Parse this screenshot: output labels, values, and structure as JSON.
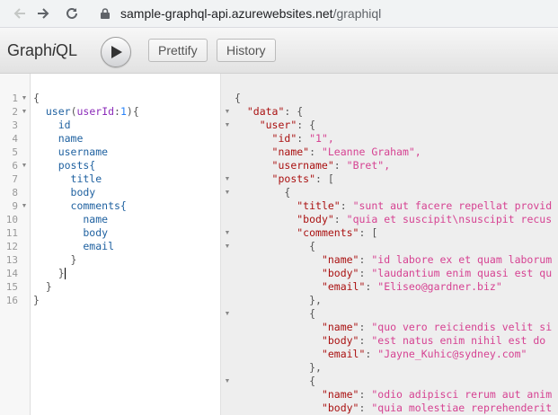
{
  "browser": {
    "url_host": "sample-graphql-api.azurewebsites.net",
    "url_path": "/graphiql"
  },
  "toolbar": {
    "logo_prefix": "Graph",
    "logo_italic": "i",
    "logo_suffix": "QL",
    "prettify_label": "Prettify",
    "history_label": "History"
  },
  "query_editor": {
    "line_numbers": [
      "1",
      "2",
      "3",
      "4",
      "5",
      "6",
      "7",
      "8",
      "9",
      "10",
      "11",
      "12",
      "13",
      "14",
      "15",
      "16"
    ],
    "lines": [
      "{",
      "  user(userId:1){",
      "    id",
      "    name",
      "    username",
      "    posts{",
      "      title",
      "      body",
      "      comments{",
      "        name",
      "        body",
      "        email",
      "      }",
      "    }",
      "  }",
      "}"
    ]
  },
  "result_viewer": {
    "lines": [
      "{",
      "  \"data\": {",
      "    \"user\": {",
      "      \"id\": \"1\",",
      "      \"name\": \"Leanne Graham\",",
      "      \"username\": \"Bret\",",
      "      \"posts\": [",
      "        {",
      "          \"title\": \"sunt aut facere repellat provid",
      "          \"body\": \"quia et suscipit\\nsuscipit recus",
      "          \"comments\": [",
      "            {",
      "              \"name\": \"id labore ex et quam laborum",
      "              \"body\": \"laudantium enim quasi est qu",
      "              \"email\": \"Eliseo@gardner.biz\"",
      "            },",
      "            {",
      "              \"name\": \"quo vero reiciendis velit si",
      "              \"body\": \"est natus enim nihil est do",
      "              \"email\": \"Jayne_Kuhic@sydney.com\"",
      "            },",
      "            {",
      "              \"name\": \"odio adipisci rerum aut anim",
      "              \"body\": \"quia molestiae reprehenderit"
    ]
  }
}
